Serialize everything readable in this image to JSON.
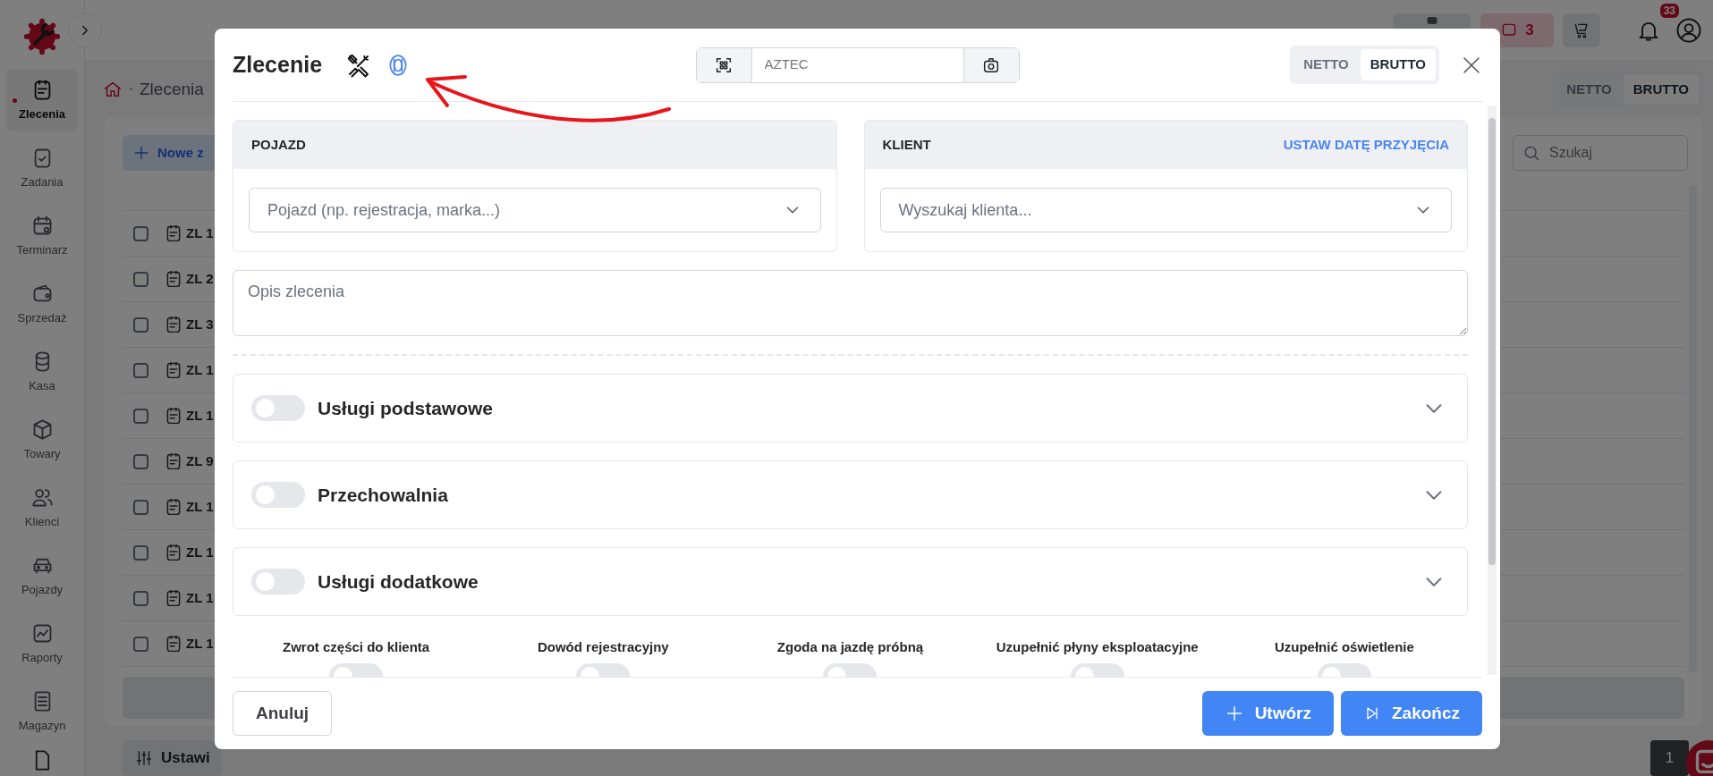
{
  "sidebar": {
    "items": [
      {
        "label": "Zlecenia",
        "selected": true
      },
      {
        "label": "Zadania",
        "selected": false
      },
      {
        "label": "Terminarz",
        "selected": false
      },
      {
        "label": "Sprzedaż",
        "selected": false
      },
      {
        "label": "Kasa",
        "selected": false
      },
      {
        "label": "Towary",
        "selected": false
      },
      {
        "label": "Klienci",
        "selected": false
      },
      {
        "label": "Pojazdy",
        "selected": false
      },
      {
        "label": "Raporty",
        "selected": false
      },
      {
        "label": "Magazyn",
        "selected": false
      }
    ]
  },
  "topbar": {
    "alert_count": "3",
    "notification_count": "33"
  },
  "page": {
    "breadcrumb": "Zlecenia",
    "price_toggle": [
      {
        "label": "NETTO",
        "selected": false
      },
      {
        "label": "BRUTTO",
        "selected": true
      }
    ],
    "new_button": "Nowe z",
    "search": {
      "placeholder": "Szukaj"
    },
    "rows": [
      {
        "number": "ZL 1",
        "checked": false
      },
      {
        "number": "ZL 2",
        "checked": false
      },
      {
        "number": "ZL 3",
        "checked": false
      },
      {
        "number": "ZL 1",
        "checked": false
      },
      {
        "number": "ZL 1",
        "checked": false
      },
      {
        "number": "ZL 9",
        "checked": false
      },
      {
        "number": "ZL 1",
        "checked": false
      },
      {
        "number": "ZL 1",
        "checked": false
      },
      {
        "number": "ZL 1",
        "checked": false
      },
      {
        "number": "ZL 1",
        "checked": false
      }
    ],
    "settings_button": "Ustawi",
    "pagination": [
      {
        "label": "1",
        "selected": true
      }
    ]
  },
  "modal": {
    "title": "Zlecenie",
    "scan": {
      "placeholder": "AZTEC"
    },
    "price_toggle": [
      {
        "label": "NETTO",
        "selected": false
      },
      {
        "label": "BRUTTO",
        "selected": true
      }
    ],
    "vehicle": {
      "header": "POJAZD",
      "placeholder": "Pojazd (np. rejestracja, marka...)"
    },
    "client": {
      "header": "KLIENT",
      "link": "USTAW DATĘ PRZYJĘCIA",
      "placeholder": "Wyszukaj klienta..."
    },
    "description": {
      "placeholder": "Opis zlecenia"
    },
    "sections": [
      {
        "label": "Usługi podstawowe",
        "on": false,
        "expanded": false
      },
      {
        "label": "Przechowalnia",
        "on": false,
        "expanded": false
      },
      {
        "label": "Usługi dodatkowe",
        "on": false,
        "expanded": false
      }
    ],
    "options": [
      {
        "label": "Zwrot części do klienta",
        "on": false
      },
      {
        "label": "Dowód rejestracyjny",
        "on": false
      },
      {
        "label": "Zgoda na jazdę próbną",
        "on": false
      },
      {
        "label": "Uzupełnić płyny eksploatacyjne",
        "on": false
      },
      {
        "label": "Uzupełnić oświetlenie",
        "on": false
      }
    ],
    "buttons": [
      {
        "kind": "cancel",
        "label": "Anuluj"
      },
      {
        "kind": "create",
        "label": "Utwórz"
      },
      {
        "kind": "finish",
        "label": "Zakończ"
      }
    ]
  }
}
